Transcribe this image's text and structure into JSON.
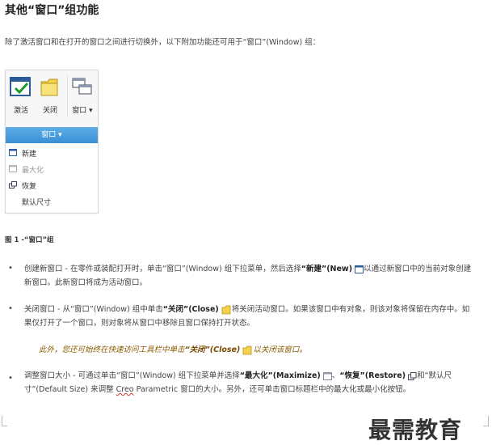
{
  "title": "其他“窗口”组功能",
  "intro": "除了激活窗口和在打开的窗口之间进行切换外，以下附加功能还可用于“窗口”(Window) 组：",
  "widget": {
    "ribbon": {
      "activate": "激活",
      "close": "关闭",
      "window": "窗口"
    },
    "group_label": "窗口",
    "menu": [
      "新建",
      "最大化",
      "恢复",
      "默认尺寸"
    ]
  },
  "caption": "图 1 -“窗口”组",
  "bullets": [
    {
      "pre": "创建新窗口 - 在零件或装配打开时，单击“窗口”(Window) 组下拉菜单，然后选择",
      "bold": "“新建”(New)",
      "post": "以通过新窗口中的当前对象创建新窗口。此新窗口将成为活动窗口。"
    },
    {
      "pre": "关闭窗口 - 从“窗口”(Window) 组中单击",
      "bold": "“关闭”(Close)",
      "post": "将关闭活动窗口。如果该窗口中有对象，则该对象将保留在内存中。如果仅打开了一个窗口，则对象将从窗口中移除且窗口保持打开状态。"
    },
    {
      "pre": "调整窗口大小 - 可通过单击“窗口”(Window) 组下拉菜单并选择",
      "bold1": "“最大化”(Maximize)",
      "mid": "、",
      "bold2": "“恢复”(Restore)",
      "mid2": "和“默认尺寸”(Default Size) 来调整",
      "creo": "Creo",
      "post": " Parametric 窗口的大小。另外，还可单击窗口标题栏中的最大化或最小化按钮。"
    }
  ],
  "note": {
    "pre": "此外，您还可始终在快速访问工具栏中单击",
    "bold": "“关闭”(Close)",
    "post": "以关闭该窗口。"
  },
  "watermark": "最需教育"
}
